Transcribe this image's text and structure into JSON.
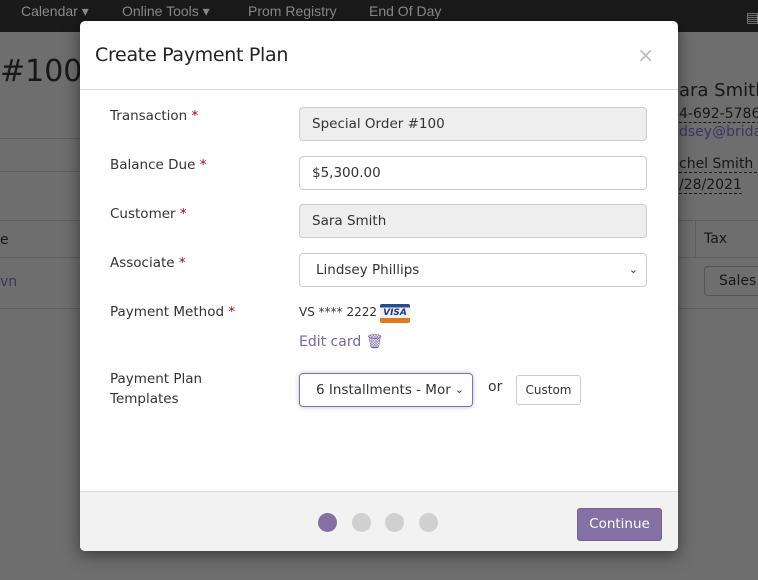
{
  "nav": {
    "items": [
      "Calendar ▾",
      "Online Tools ▾",
      "Prom Registry",
      "End Of Day"
    ]
  },
  "background": {
    "title": "#100",
    "customer_name": "ara Smith",
    "phone": "4-692-5786",
    "email": "dsey@bridal",
    "event": "chel Smith E",
    "date": "/28/2021",
    "col_left": "e",
    "col_tax": "Tax",
    "row_link": "vn",
    "sales_button": "Sales T"
  },
  "modal": {
    "title": "Create Payment Plan",
    "close": "×",
    "fields": {
      "transaction": {
        "label": "Transaction",
        "value": "Special Order #100"
      },
      "balance_due": {
        "label": "Balance Due",
        "value": "$5,300.00"
      },
      "customer": {
        "label": "Customer",
        "value": "Sara Smith"
      },
      "associate": {
        "label": "Associate",
        "value": "Lindsey Phillips"
      },
      "payment_method": {
        "label": "Payment Method",
        "card": "VS **** 2222",
        "card_brand": "VISA",
        "edit": "Edit card"
      },
      "templates": {
        "label": "Payment Plan Templates",
        "value": "6 Installments - Mor",
        "or": "or",
        "custom": "Custom"
      }
    },
    "required_mark": "*",
    "steps": {
      "total": 4,
      "current": 1
    },
    "continue": "Continue"
  },
  "colors": {
    "accent": "#8570a3"
  }
}
